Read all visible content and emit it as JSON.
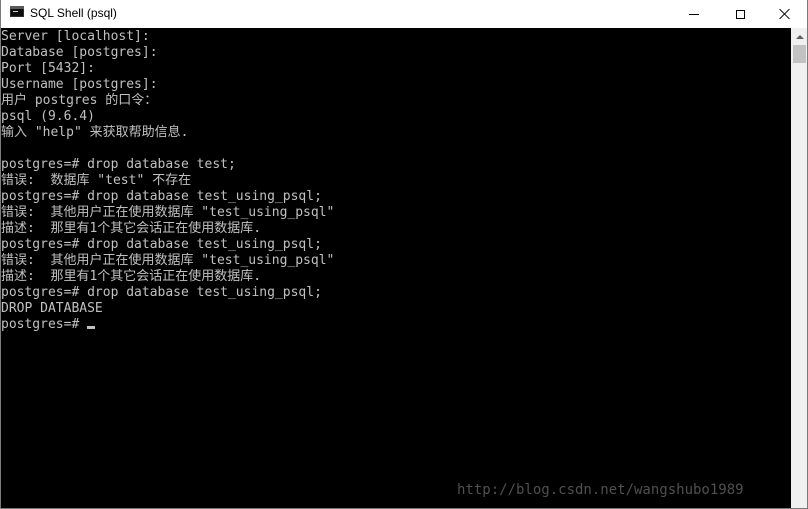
{
  "window": {
    "title": "SQL Shell (psql)",
    "icon": "console-window-icon",
    "controls": {
      "minimize_icon": "minimize-icon",
      "maximize_icon": "maximize-icon",
      "close_icon": "close-icon"
    }
  },
  "console": {
    "text_color": "#c0c0c0",
    "background_color": "#000000",
    "lines": [
      "Server [localhost]:",
      "Database [postgres]:",
      "Port [5432]:",
      "Username [postgres]:",
      "用户 postgres 的口令：",
      "psql (9.6.4)",
      "输入 \"help\" 来获取帮助信息.",
      "",
      "postgres=# drop database test;",
      "错误:  数据库 \"test\" 不存在",
      "postgres=# drop database test_using_psql;",
      "错误:  其他用户正在使用数据库 \"test_using_psql\"",
      "描述:  那里有1个其它会话正在使用数据库.",
      "postgres=# drop database test_using_psql;",
      "错误:  其他用户正在使用数据库 \"test_using_psql\"",
      "描述:  那里有1个其它会话正在使用数据库.",
      "postgres=# drop database test_using_psql;",
      "DROP DATABASE"
    ],
    "prompt": "postgres=# "
  },
  "watermark": "http://blog.csdn.net/wangshubo1989"
}
